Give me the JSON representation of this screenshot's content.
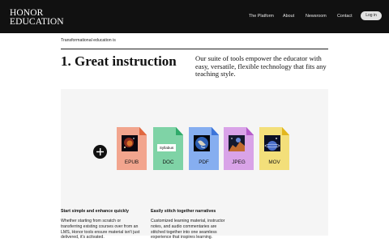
{
  "brand": {
    "line1": "HONOR",
    "line2": "EDUCATION"
  },
  "nav": {
    "items": [
      "The Platform",
      "About",
      "Newsroom",
      "Contact"
    ],
    "login_label": "Log in"
  },
  "hero": {
    "eyebrow": "Transformational education is",
    "headline": "1. Great instruction",
    "intro": "Our suite of tools empower the educator with easy, versatile, flexible technology that fits any teaching style."
  },
  "files": [
    {
      "label": "EPUB",
      "color": "#f2a58e",
      "fold": "#e06840",
      "icon": "nebula-thumbnail-icon"
    },
    {
      "label": "DOC",
      "color": "#7fd3a6",
      "fold": "#2faa6a",
      "icon": "syllabus-card-icon",
      "card": "Syllabus"
    },
    {
      "label": "PDF",
      "color": "#86aef0",
      "fold": "#3c74d9",
      "icon": "earth-thumbnail-icon"
    },
    {
      "label": "JPEG",
      "color": "#d9a3e8",
      "fold": "#b55ccb",
      "icon": "galaxy-thumbnail-icon"
    },
    {
      "label": "MOV",
      "color": "#f3df7a",
      "fold": "#e2b61e",
      "icon": "planet-thumbnail-icon"
    }
  ],
  "features": [
    {
      "title": "Start simple and enhance quickly",
      "body": "Whether starting from scratch or transferring existing courses over from an LMS, Honor tools ensure material isn't just delivered, it's activated."
    },
    {
      "title": "Easily stitch together narratives",
      "body": "Customized learning material, instructor notes, and audio commentaries are stitched together into one seamless experience that inspires learning."
    }
  ],
  "colors": {
    "header_bg": "#111111",
    "panel_bg": "#f5f5f5",
    "login_bg": "#e2e2e2"
  }
}
